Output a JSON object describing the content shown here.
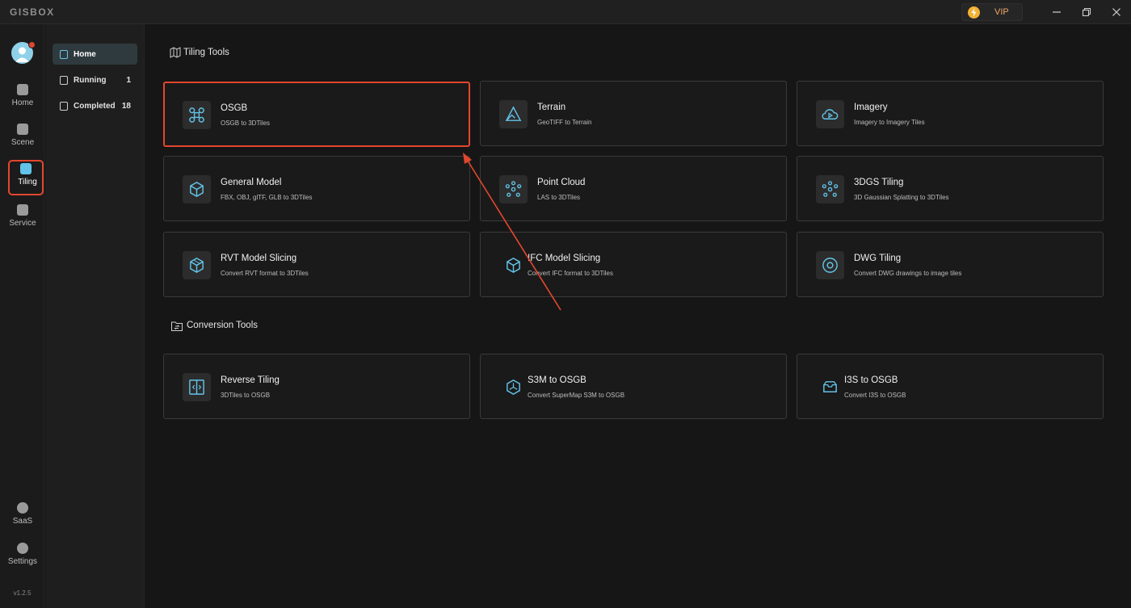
{
  "app": {
    "logo": "GISBOX",
    "vip_label": "VIP"
  },
  "rail": {
    "items": [
      {
        "label": "Home"
      },
      {
        "label": "Scene"
      },
      {
        "label": "Tiling"
      },
      {
        "label": "Service"
      },
      {
        "label": "SaaS"
      },
      {
        "label": "Settings"
      }
    ],
    "version": "v1.2.5"
  },
  "subnav": {
    "items": [
      {
        "label": "Home",
        "count": ""
      },
      {
        "label": "Running",
        "count": "1"
      },
      {
        "label": "Completed",
        "count": "18"
      }
    ]
  },
  "tiling": {
    "title": "Tiling Tools",
    "cards": [
      {
        "title": "OSGB",
        "subtitle": "OSGB to 3DTiles",
        "icon": "drone-icon"
      },
      {
        "title": "Terrain",
        "subtitle": "GeoTIFF to Terrain",
        "icon": "mountain-icon"
      },
      {
        "title": "Imagery",
        "subtitle": "Imagery to Imagery Tiles",
        "icon": "cloud-play-icon"
      },
      {
        "title": "General Model",
        "subtitle": "FBX, OBJ, glTF, GLB to 3DTiles",
        "icon": "cube-icon"
      },
      {
        "title": "Point Cloud",
        "subtitle": "LAS to 3DTiles",
        "icon": "point-cloud-icon"
      },
      {
        "title": "3DGS Tiling",
        "subtitle": "3D Gaussian Splatting to 3DTiles",
        "icon": "gaussian-icon"
      },
      {
        "title": "RVT Model Slicing",
        "subtitle": "Convert RVT format to 3DTiles",
        "icon": "rvt-cube-icon"
      },
      {
        "title": "IFC Model Slicing",
        "subtitle": "Convert IFC format to 3DTiles",
        "icon": "ifc-cube-icon"
      },
      {
        "title": "DWG Tiling",
        "subtitle": "Convert DWG drawings to image tiles",
        "icon": "dwg-circle-icon"
      }
    ]
  },
  "conversion": {
    "title": "Conversion Tools",
    "cards": [
      {
        "title": "Reverse Tiling",
        "subtitle": "3DTiles to OSGB",
        "icon": "reverse-icon"
      },
      {
        "title": "S3M to OSGB",
        "subtitle": "Convert SuperMap S3M to OSGB",
        "icon": "hex-icon"
      },
      {
        "title": "I3S to OSGB",
        "subtitle": "Convert I3S to OSGB",
        "icon": "box-open-icon"
      }
    ]
  },
  "colors": {
    "accent": "#62c3e8",
    "highlight": "#e2472e",
    "background": "#161616"
  }
}
